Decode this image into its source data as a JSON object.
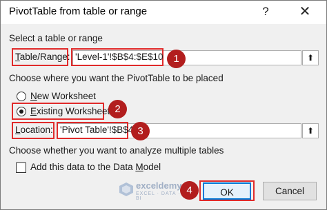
{
  "dialog": {
    "title": "PivotTable from table or range",
    "help_glyph": "?",
    "close_glyph": "✕"
  },
  "source_section": {
    "label": "Select a table or range",
    "field_label_prefix": "T",
    "field_label_rest": "able/Range:",
    "field_value": "'Level-1'!$B$4:$E$10"
  },
  "placement_section": {
    "label": "Choose where you want the PivotTable to be placed",
    "options": [
      {
        "label_prefix": "N",
        "label_rest": "ew Worksheet",
        "selected": false
      },
      {
        "label_prefix": "E",
        "label_rest": "xisting Worksheet",
        "selected": true
      }
    ],
    "location_label_prefix": "L",
    "location_label_rest": "ocation:",
    "location_value": "'Pivot Table'!$B$4"
  },
  "multiple_tables_section": {
    "label": "Choose whether you want to analyze multiple tables",
    "checkbox_label_prefix": "Add this data to the Data ",
    "checkbox_label_u": "M",
    "checkbox_label_rest": "odel",
    "checked": false
  },
  "buttons": {
    "ok": "OK",
    "cancel": "Cancel"
  },
  "annotations": {
    "step1": "1",
    "step2": "2",
    "step3": "3",
    "step4": "4",
    "accent_color": "#b21e1e",
    "highlight_color": "#e02a2a"
  },
  "watermark": {
    "name": "exceldemy",
    "tagline": "EXCEL · DATA · BI"
  }
}
